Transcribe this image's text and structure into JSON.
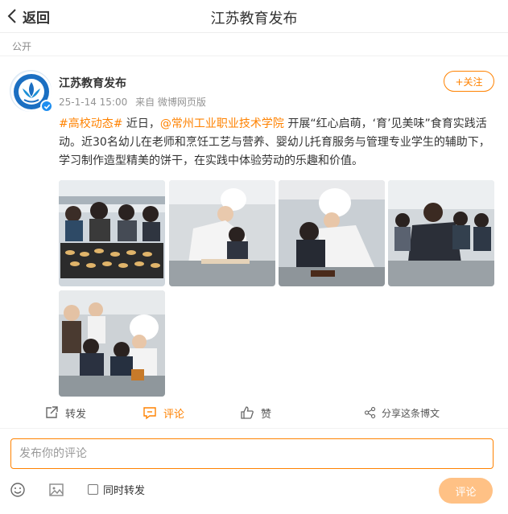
{
  "header": {
    "back_label": "返回",
    "title": "江苏教育发布",
    "back_icon": "chevron-left-icon"
  },
  "post": {
    "visibility": "公开",
    "author": {
      "name": "江苏教育发布",
      "verified": true,
      "avatar_icon": "jiangsu-education-logo"
    },
    "timestamp": "25-1-14 15:00",
    "source": "来自 微博网页版",
    "follow_label": "+关注",
    "text": {
      "hashtag": "#高校动态#",
      "part1": " 近日，",
      "mention": "@常州工业职业技术学院",
      "part2": " 开展“红心启萌，‘育’见美味”食育实践活动。近30名幼儿在老师和烹饪工艺与营养、婴幼儿托育服务与管理专业学生的辅助下，学习制作造型精美的饼干，在实践中体验劳动的乐趣和价值。"
    },
    "images": [
      {
        "description_icon": "children-with-cookie-tray-photo"
      },
      {
        "description_icon": "chef-helping-child-photo"
      },
      {
        "description_icon": "chef-and-boy-cutting-dough-photo"
      },
      {
        "description_icon": "teacher-and-children-at-table-photo"
      },
      {
        "description_icon": "students-shaping-dough-photo"
      }
    ]
  },
  "actions": {
    "repost": "转发",
    "comment": "评论",
    "like": "赞",
    "share": "分享这条博文"
  },
  "composer": {
    "placeholder": "发布你的评论",
    "repost_checkbox_label": "同时转发",
    "submit_label": "评论"
  },
  "colors": {
    "accent": "#ff8200",
    "submit_disabled": "#ffc185",
    "verified": "#1e8ef0"
  }
}
